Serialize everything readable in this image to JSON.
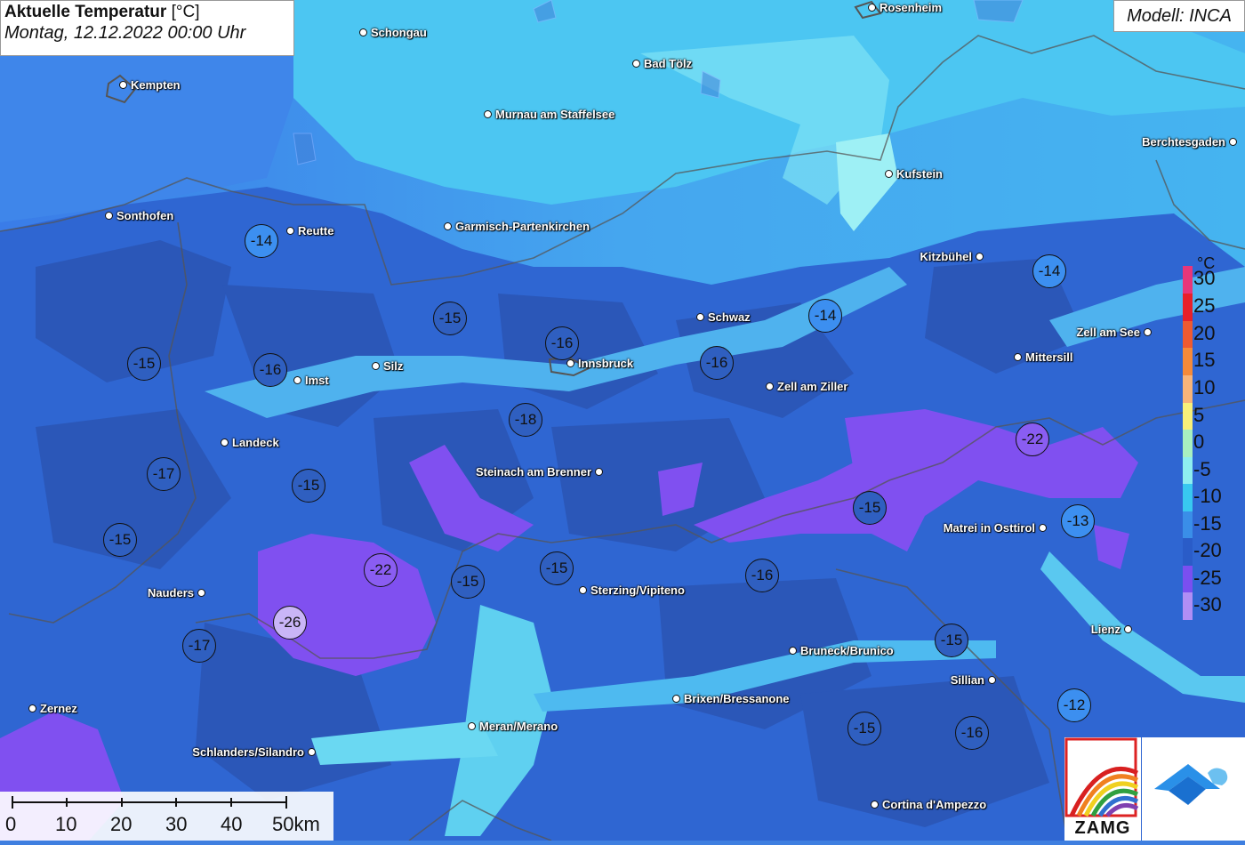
{
  "title": {
    "line1_bold": "Aktuelle Temperatur",
    "line1_unit": " [°C]",
    "line2": "Montag, 12.12.2022 00:00 Uhr"
  },
  "model_label": "Modell: INCA",
  "legend": {
    "unit": "°C",
    "steps": [
      {
        "label": "30",
        "color": "#e8367a"
      },
      {
        "label": "25",
        "color": "#e8202a"
      },
      {
        "label": "20",
        "color": "#ef5a30"
      },
      {
        "label": "15",
        "color": "#f58a3a"
      },
      {
        "label": "10",
        "color": "#f7b47a"
      },
      {
        "label": "5",
        "color": "#f8f07a"
      },
      {
        "label": "0",
        "color": "#a8f0c0"
      },
      {
        "label": "-5",
        "color": "#8eeef0"
      },
      {
        "label": "-10",
        "color": "#38c8f0"
      },
      {
        "label": "-15",
        "color": "#3a8ee8"
      },
      {
        "label": "-20",
        "color": "#2a5cc8"
      },
      {
        "label": "-25",
        "color": "#7a4ff0"
      },
      {
        "label": "-30",
        "color": "#b08ef5"
      }
    ]
  },
  "scale": {
    "labels": [
      "0",
      "10",
      "20",
      "30",
      "40",
      "50km"
    ]
  },
  "logos": {
    "zamg": "ZAMG",
    "geosphere_icon": "geosphere-logo-icon"
  },
  "cities": [
    {
      "name": "Rosenheim",
      "side": "right"
    },
    {
      "name": "Schongau",
      "side": "right"
    },
    {
      "name": "Kempten",
      "side": "right"
    },
    {
      "name": "Bad Tölz",
      "side": "right"
    },
    {
      "name": "Murnau am Staffelsee",
      "side": "right"
    },
    {
      "name": "Berchtesgaden",
      "side": "left"
    },
    {
      "name": "Kufstein",
      "side": "right"
    },
    {
      "name": "Sonthofen",
      "side": "right"
    },
    {
      "name": "Reutte",
      "side": "right"
    },
    {
      "name": "Garmisch-Partenkirchen",
      "side": "right"
    },
    {
      "name": "Kitzbühel",
      "side": "left"
    },
    {
      "name": "Schwaz",
      "side": "right"
    },
    {
      "name": "Zell am See",
      "side": "left"
    },
    {
      "name": "Innsbruck",
      "side": "right"
    },
    {
      "name": "Silz",
      "side": "right"
    },
    {
      "name": "Imst",
      "side": "right"
    },
    {
      "name": "Mittersill",
      "side": "right"
    },
    {
      "name": "Zell am Ziller",
      "side": "right"
    },
    {
      "name": "Landeck",
      "side": "right"
    },
    {
      "name": "Steinach am Brenner",
      "side": "left"
    },
    {
      "name": "Matrei in Osttirol",
      "side": "left"
    },
    {
      "name": "Nauders",
      "side": "left"
    },
    {
      "name": "Sterzing/Vipiteno",
      "side": "right"
    },
    {
      "name": "Lienz",
      "side": "left"
    },
    {
      "name": "Bruneck/Brunico",
      "side": "right"
    },
    {
      "name": "Sillian",
      "side": "left"
    },
    {
      "name": "Brixen/Bressanone",
      "side": "right"
    },
    {
      "name": "Zernez",
      "side": "right"
    },
    {
      "name": "Meran/Merano",
      "side": "right"
    },
    {
      "name": "Schlanders/Silandro",
      "side": "left"
    },
    {
      "name": "Cortina d'Ampezzo",
      "side": "right"
    }
  ],
  "station_temps": [
    "-14",
    "-14",
    "-15",
    "-16",
    "-14",
    "-15",
    "-16",
    "-16",
    "-18",
    "-17",
    "-15",
    "-22",
    "-15",
    "-13",
    "-15",
    "-22",
    "-15",
    "-15",
    "-16",
    "-26",
    "-17",
    "-15",
    "-12",
    "-15",
    "-16"
  ]
}
